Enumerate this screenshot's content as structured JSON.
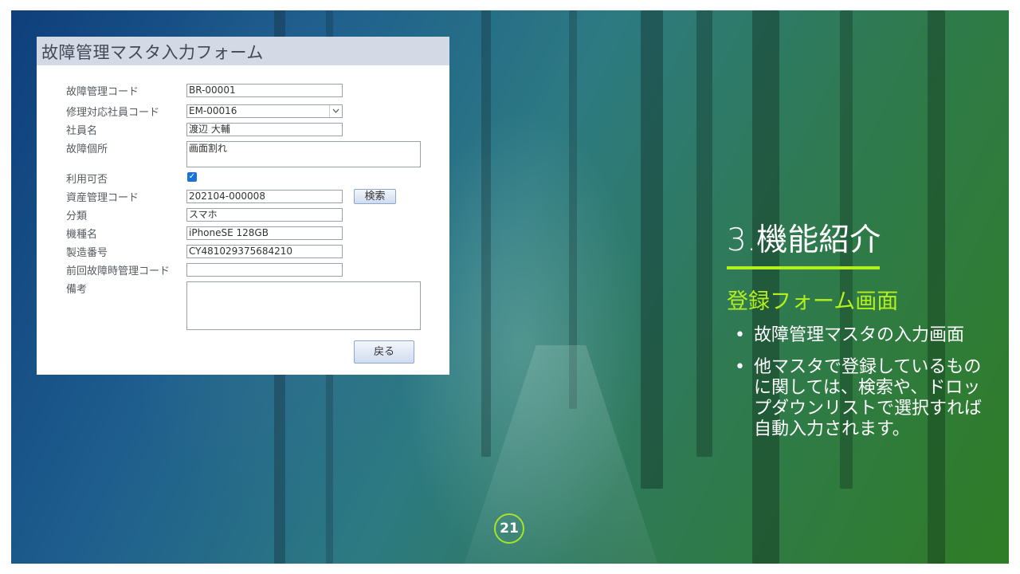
{
  "form": {
    "title": "故障管理マスタ入力フォーム",
    "fields": [
      {
        "label": "故障管理コード",
        "value": "BR-00001"
      },
      {
        "label": "修理対応社員コード",
        "value": "EM-00016"
      },
      {
        "label": "社員名",
        "value": "渡辺  大輔"
      },
      {
        "label": "故障個所",
        "value": "画面割れ"
      },
      {
        "label": "利用可否",
        "checked": true
      },
      {
        "label": "資産管理コード",
        "value": "202104-000008"
      },
      {
        "label": "分類",
        "value": "スマホ"
      },
      {
        "label": "機種名",
        "value": "iPhoneSE 128GB"
      },
      {
        "label": "製造番号",
        "value": "CY481029375684210"
      },
      {
        "label": "前回故障時管理コード",
        "value": ""
      },
      {
        "label": "備考",
        "value": ""
      }
    ],
    "search_button": "検索",
    "back_button": "戻る",
    "select_arrow": "chevron-down-icon",
    "check_mark": "✓"
  },
  "slide": {
    "section_title": "3.機能紹介",
    "subtitle": "登録フォーム画面",
    "bullets": [
      "故障管理マスタの入力画面",
      "他マスタで登録しているものに関しては、検索や、ドロップダウンリストで選択すれば自動入力されます。"
    ],
    "bullet_glyph": "•",
    "page_number": "21"
  },
  "colors": {
    "accent": "#b4f01e",
    "form_header": "#d3dae6",
    "checkbox": "#1a73d6"
  }
}
